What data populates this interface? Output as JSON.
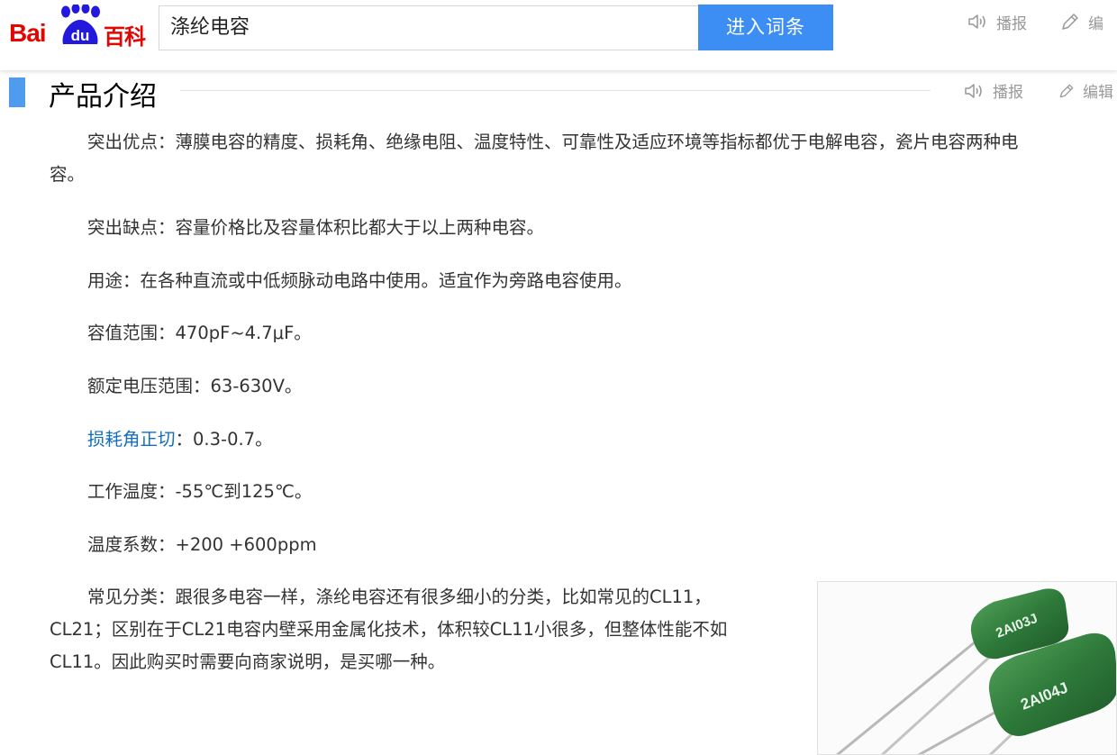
{
  "header": {
    "logo_bai": "Bai",
    "logo_du": "du",
    "logo_baike": "百科",
    "search_value": "涤纶电容",
    "search_button": "进入词条",
    "read_label": "播报",
    "edit_label": "编"
  },
  "section": {
    "title": "产品介绍",
    "read_label": "播报",
    "edit_label": "编辑"
  },
  "paragraphs": {
    "p1": "突出优点：薄膜电容的精度、损耗角、绝缘电阻、温度特性、可靠性及适应环境等指标都优于电解电容，瓷片电容两种电",
    "p1_cont": "容。",
    "p2": "突出缺点：容量价格比及容量体积比都大于以上两种电容。",
    "p3": "用途：在各种直流或中低频脉动电路中使用。适宜作为旁路电容使用。",
    "p4": "容值范围：470pF~4.7μF。",
    "p5": "额定电压范围：63-630V。",
    "p6_link": "损耗角正切",
    "p6_rest": "：0.3-0.7。",
    "p7": "工作温度：-55℃到125℃。",
    "p8": "温度系数：+200 +600ppm",
    "p9_l1": "常见分类：跟很多电容一样，涤纶电容还有很多细小的分类，比如常见的CL11，",
    "p9_l2": "CL21；区别在于CL21电容内壁采用金属化技术，体积较CL11小很多，但整体性能不如",
    "p9_l3": "CL11。因此购买时需要向商家说明，是买哪一种。"
  },
  "figure": {
    "cap1_marking": "2AI03J",
    "cap2_marking": "2AI04J"
  },
  "colors": {
    "brand_red": "#e10602",
    "brand_blue": "#2319dc",
    "button_blue": "#3c8ef5",
    "section_bar": "#4f9cee",
    "link": "#136ec2",
    "capacitor_green": "#2e7a3a"
  },
  "icons": {
    "read": "speaker-icon",
    "edit": "pencil-icon",
    "logo_paw": "paw-icon"
  }
}
